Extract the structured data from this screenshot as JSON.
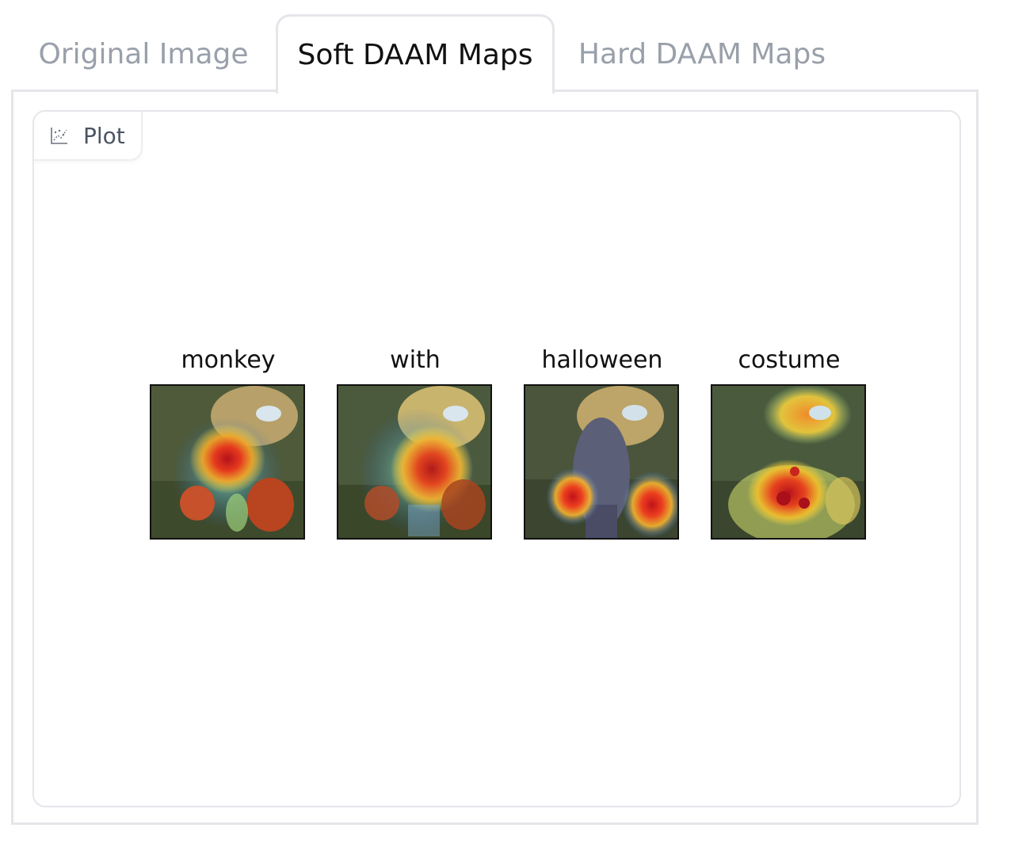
{
  "tabs": [
    {
      "label": "Original Image",
      "active": false
    },
    {
      "label": "Soft DAAM Maps",
      "active": true
    },
    {
      "label": "Hard DAAM Maps",
      "active": false
    }
  ],
  "plot": {
    "label": "Plot",
    "icon": "chart-icon"
  },
  "figure": {
    "panels": [
      {
        "title": "monkey",
        "heat": "chest"
      },
      {
        "title": "with",
        "heat": "torso"
      },
      {
        "title": "halloween",
        "heat": "pumpkins"
      },
      {
        "title": "costume",
        "heat": "lower-body"
      }
    ]
  },
  "colors": {
    "tab_active": "#111111",
    "tab_inactive": "#9aa0aa",
    "border": "#e4e6ea",
    "heat_hot": "#c81e1e",
    "heat_warm": "#f2c02c",
    "heat_cool": "#3a7bd5"
  }
}
